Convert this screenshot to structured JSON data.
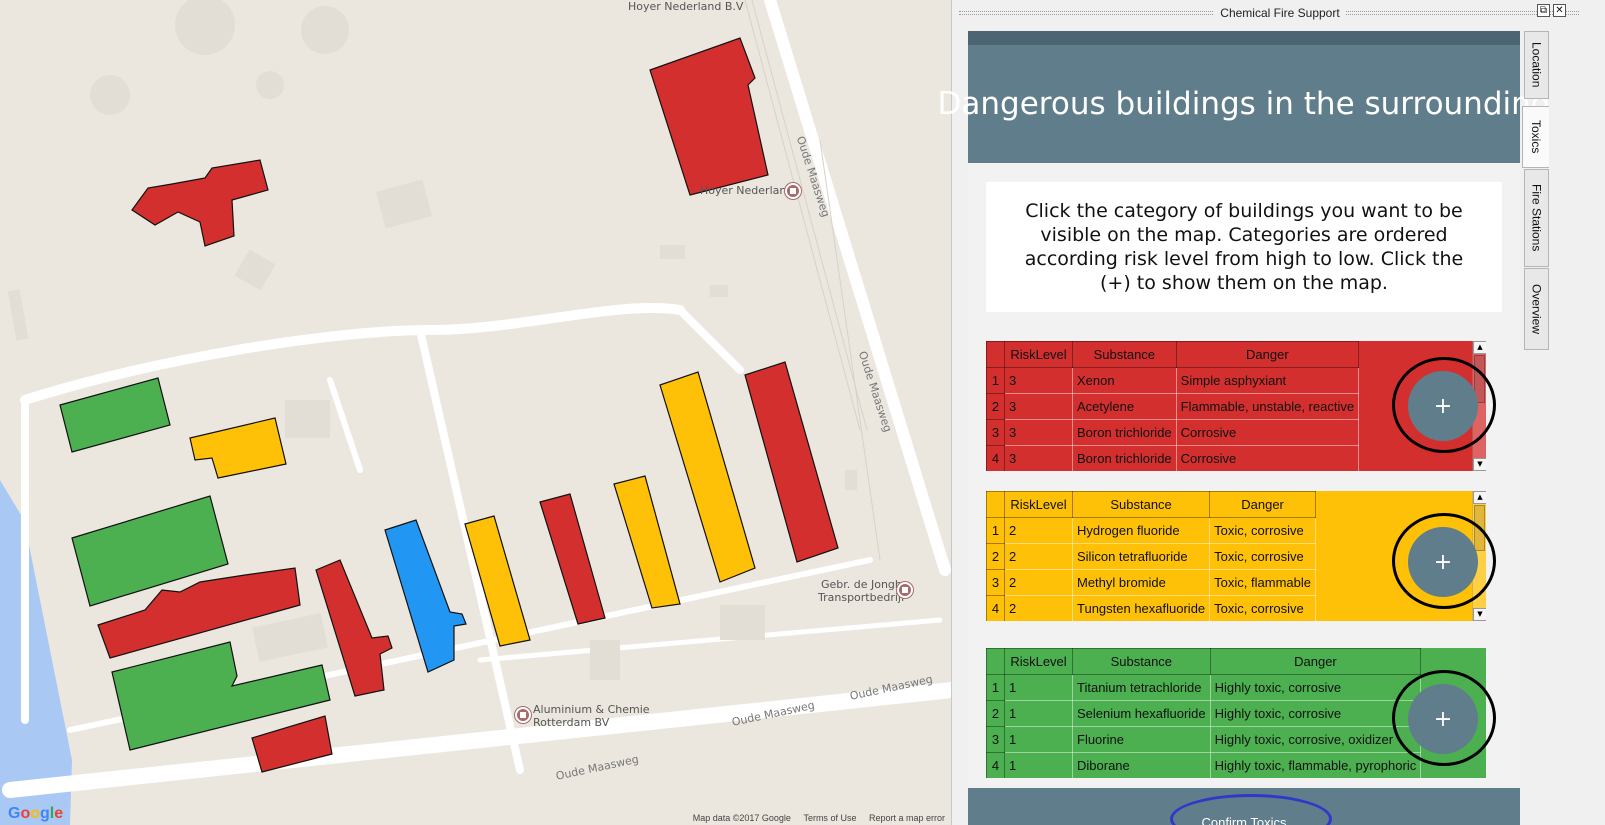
{
  "map": {
    "labels": {
      "hoyer_top": "Hoyer Nederland B.V",
      "hoyer_poi": "Hoyer Nederland",
      "jongh_line1": "Gebr. de Jongh",
      "jongh_line2": "Transportbedrijf",
      "alu_line1": "Aluminium & Chemie",
      "alu_line2": "Rotterdam BV"
    },
    "streets": {
      "s1": "Oude Maasweg",
      "s2": "Oude Maasweg",
      "s3": "Oude Maasweg",
      "s4": "Oude Maasweg",
      "s5": "Oude Maasweg"
    },
    "logo": "Google",
    "attribution": {
      "map_data": "Map data ©2017 Google",
      "terms": "Terms of Use",
      "report": "Report a map error"
    },
    "colors": {
      "red": "#d32f2f",
      "yellow": "#ffc107",
      "green": "#4caf50",
      "blue": "#2196f3",
      "water": "#a9c8f4",
      "land": "#ebe7df"
    }
  },
  "dock": {
    "title": "Chemical Fire Support",
    "float_icon": "⧉",
    "close_icon": "✕"
  },
  "panel": {
    "header": "Dangerous buildings in the surrounding",
    "instructions": "Click the category of buildings you want to be visible on the map. Categories are ordered according risk level from high to low. Click the (+) to show them on the map.",
    "columns": [
      "RiskLevel",
      "Substance",
      "Danger"
    ],
    "add_label": "+",
    "blocks": [
      {
        "color": "#d32f2f",
        "rows": [
          [
            "1",
            "3",
            "Xenon",
            "Simple asphyxiant"
          ],
          [
            "2",
            "3",
            "Acetylene",
            "Flammable, unstable, reactive"
          ],
          [
            "3",
            "3",
            "Boron trichloride",
            "Corrosive"
          ],
          [
            "4",
            "3",
            "Boron trichloride",
            "Corrosive"
          ]
        ]
      },
      {
        "color": "#ffc107",
        "rows": [
          [
            "1",
            "2",
            "Hydrogen fluoride",
            "Toxic, corrosive"
          ],
          [
            "2",
            "2",
            "Silicon tetrafluoride",
            "Toxic, corrosive"
          ],
          [
            "3",
            "2",
            "Methyl bromide",
            "Toxic, flammable"
          ],
          [
            "4",
            "2",
            "Tungsten hexafluoride",
            "Toxic, corrosive"
          ]
        ]
      },
      {
        "color": "#4caf50",
        "rows": [
          [
            "1",
            "1",
            "Titanium tetrachloride",
            "Highly toxic, corrosive"
          ],
          [
            "2",
            "1",
            "Selenium hexafluoride",
            "Highly toxic, corrosive"
          ],
          [
            "3",
            "1",
            "Fluorine",
            "Highly toxic, corrosive, oxidizer"
          ],
          [
            "4",
            "1",
            "Diborane",
            "Highly toxic, flammable, pyrophoric"
          ]
        ]
      }
    ],
    "confirm": "Confirm Toxics"
  },
  "tabs": [
    "Location",
    "Toxics",
    "Fire Stations",
    "Overview"
  ],
  "active_tab": "Toxics",
  "theme": {
    "panel_header": "#607d8b",
    "panel_strip": "#4d6572",
    "confirm_ring": "#2d39c9"
  }
}
